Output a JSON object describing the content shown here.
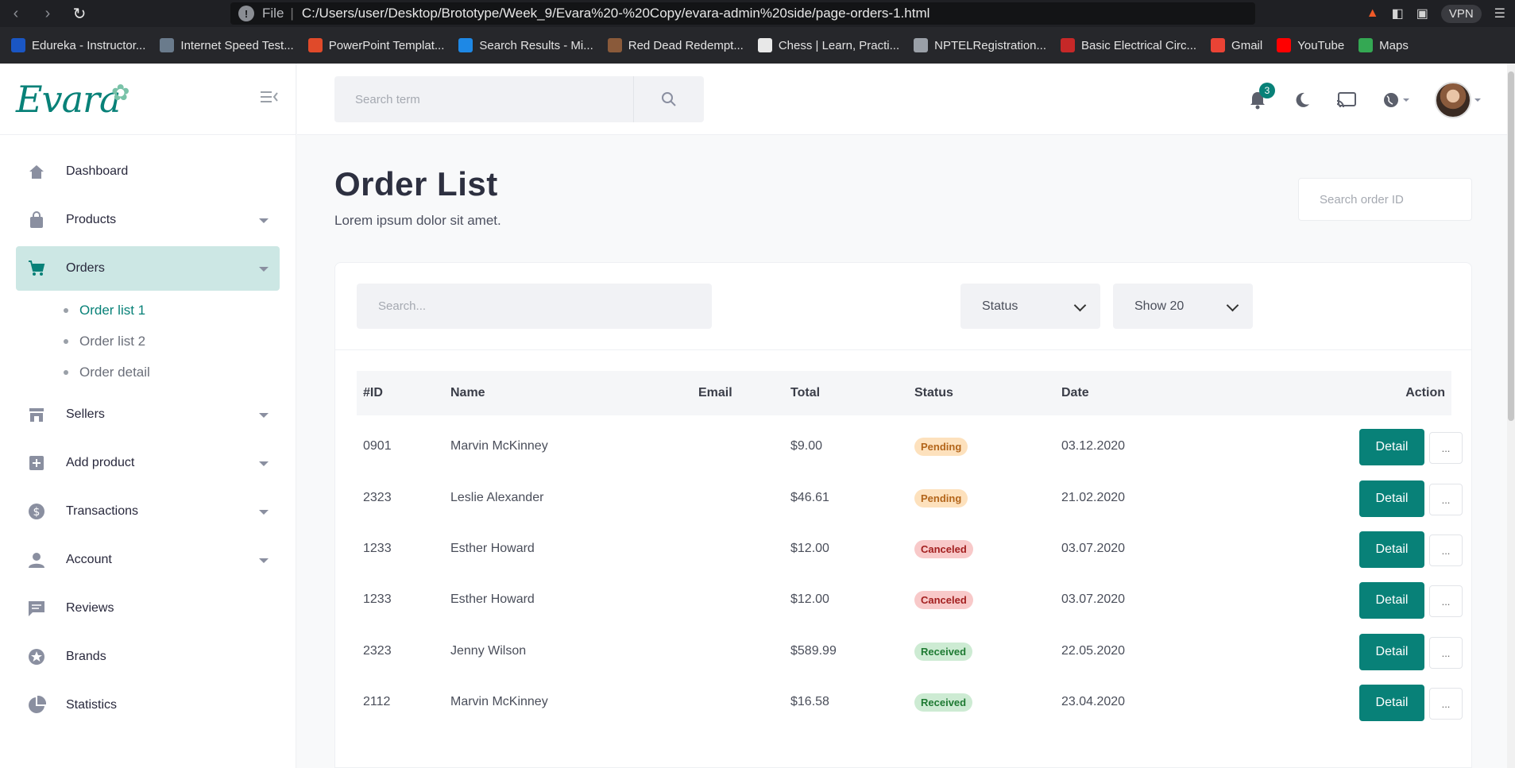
{
  "browser": {
    "address_label": "File",
    "url": "C:/Users/user/Desktop/Brototype/Week_9/Evara%20-%20Copy/evara-admin%20side/page-orders-1.html",
    "vpn_label": "VPN",
    "bookmarks": [
      {
        "label": "Edureka - Instructor...",
        "color": "#1a56c4"
      },
      {
        "label": "Internet Speed Test...",
        "color": "#6a7b8c"
      },
      {
        "label": "PowerPoint Templat...",
        "color": "#e04a2a"
      },
      {
        "label": "Search Results - Mi...",
        "color": "#1e88e5"
      },
      {
        "label": "Red Dead Redempt...",
        "color": "#8a5a3a"
      },
      {
        "label": "Chess | Learn, Practi...",
        "color": "#e8e8e8"
      },
      {
        "label": "NPTELRegistration...",
        "color": "#9aa0a8"
      },
      {
        "label": "Basic Electrical Circ...",
        "color": "#c62828"
      },
      {
        "label": "Gmail",
        "color": "#ea4335"
      },
      {
        "label": "YouTube",
        "color": "#ff0000"
      },
      {
        "label": "Maps",
        "color": "#34a853"
      }
    ]
  },
  "sidebar": {
    "logo_text": "Evara",
    "items": [
      {
        "label": "Dashboard",
        "icon": "home-icon",
        "has_caret": false
      },
      {
        "label": "Products",
        "icon": "shopping-bag-icon",
        "has_caret": true
      },
      {
        "label": "Orders",
        "icon": "shopping-cart-icon",
        "has_caret": true,
        "active": true
      },
      {
        "label": "Sellers",
        "icon": "store-icon",
        "has_caret": true
      },
      {
        "label": "Add product",
        "icon": "add-box-icon",
        "has_caret": true
      },
      {
        "label": "Transactions",
        "icon": "dollar-icon",
        "has_caret": true
      },
      {
        "label": "Account",
        "icon": "person-icon",
        "has_caret": true
      },
      {
        "label": "Reviews",
        "icon": "comment-icon",
        "has_caret": false
      },
      {
        "label": "Brands",
        "icon": "star-icon",
        "has_caret": false
      },
      {
        "label": "Statistics",
        "icon": "pie-chart-icon",
        "has_caret": false
      }
    ],
    "orders_sub": [
      "Order list 1",
      "Order list 2",
      "Order detail"
    ]
  },
  "header": {
    "search_placeholder": "Search term",
    "notification_count": "3"
  },
  "main": {
    "title": "Order List",
    "subtitle": "Lorem ipsum dolor sit amet.",
    "order_search_placeholder": "Search order ID",
    "filter_search_placeholder": "Search...",
    "status_select": "Status",
    "show_select": "Show 20",
    "columns": [
      "#ID",
      "Name",
      "Email",
      "Total",
      "Status",
      "Date",
      "Action"
    ],
    "detail_label": "Detail",
    "more_label": "...",
    "rows": [
      {
        "id": "0901",
        "name": "Marvin McKinney",
        "email": "",
        "total": "$9.00",
        "status": "Pending",
        "status_type": "pending",
        "date": "03.12.2020"
      },
      {
        "id": "2323",
        "name": "Leslie Alexander",
        "email": "",
        "total": "$46.61",
        "status": "Pending",
        "status_type": "pending",
        "date": "21.02.2020"
      },
      {
        "id": "1233",
        "name": "Esther Howard",
        "email": "",
        "total": "$12.00",
        "status": "Canceled",
        "status_type": "canceled",
        "date": "03.07.2020"
      },
      {
        "id": "1233",
        "name": "Esther Howard",
        "email": "",
        "total": "$12.00",
        "status": "Canceled",
        "status_type": "canceled",
        "date": "03.07.2020"
      },
      {
        "id": "2323",
        "name": "Jenny Wilson",
        "email": "",
        "total": "$589.99",
        "status": "Received",
        "status_type": "received",
        "date": "22.05.2020"
      },
      {
        "id": "2112",
        "name": "Marvin McKinney",
        "email": "",
        "total": "$16.58",
        "status": "Received",
        "status_type": "received",
        "date": "23.04.2020"
      }
    ]
  },
  "colors": {
    "accent": "#088178",
    "active_bg": "#cce7e4"
  }
}
